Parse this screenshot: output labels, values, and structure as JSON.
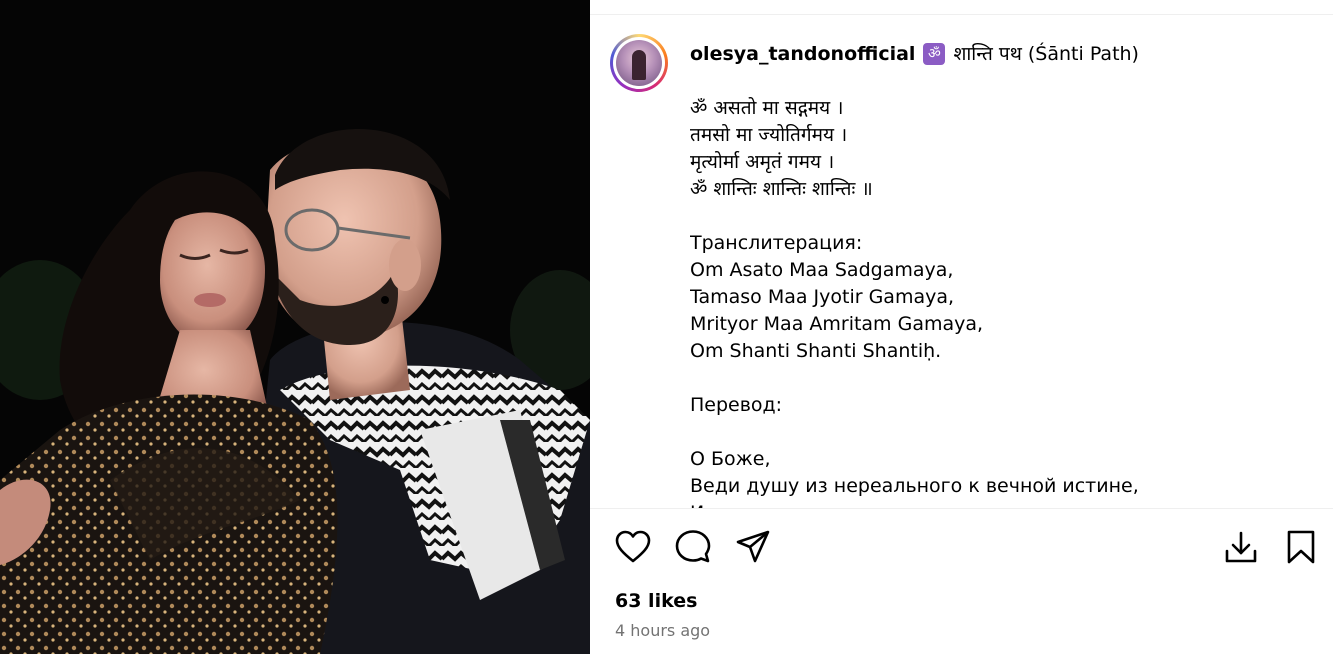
{
  "post": {
    "username": "olesya_tandonofficial",
    "title_icon": "om-icon",
    "title_icon_glyph": "ॐ",
    "title_text": "शान्ति पथ (Śānti Path)",
    "lines": [
      "ॐ असतो मा सद्गमय ।",
      "तमसो मा ज्योतिर्गमय ।",
      "मृत्योर्मा अमृतं गमय ।",
      "ॐ शान्तिः शान्तिः शान्तिः ॥",
      "",
      "Транслитерация:",
      "Om Asato Maa Sadgamaya,",
      "Tamaso Maa Jyotir Gamaya,",
      "Mrityor Maa Amritam Gamaya,",
      "Om Shanti Shanti Shantiḥ.",
      "",
      "Перевод:",
      "",
      "О Боже,",
      "Веди душу из нереального к вечной истине,",
      "И..."
    ]
  },
  "actions": {
    "like": "heart-icon",
    "comment": "comment-icon",
    "share": "share-icon",
    "download": "download-icon",
    "save": "bookmark-icon"
  },
  "likes_text": "63 likes",
  "time_text": "4 hours ago",
  "colors": {
    "accent_om": "#8b5cc4",
    "meta_gray": "#737373",
    "divider": "#efefef"
  }
}
